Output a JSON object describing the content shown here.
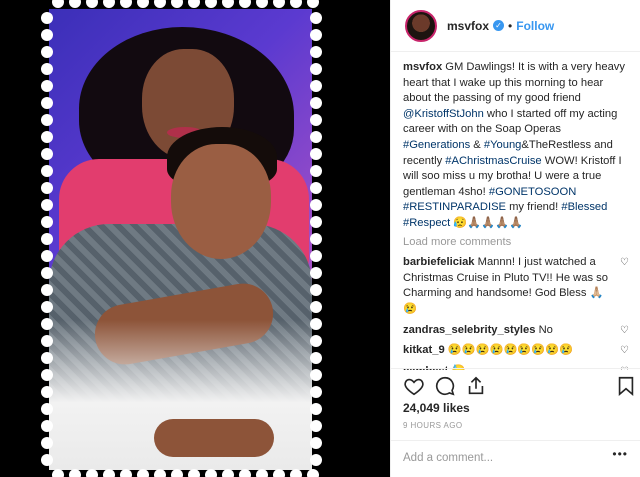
{
  "post": {
    "username": "msvfox",
    "verified_icon": "verified-badge-icon",
    "dot": "•",
    "follow_label": "Follow"
  },
  "caption": {
    "username": "msvfox",
    "parts": [
      {
        "t": "GM Dawlings! It is with a very heavy heart that I wake up this morning to hear about the passing of my good friend ",
        "tag": false
      },
      {
        "t": "@KristoffStJohn",
        "tag": true
      },
      {
        "t": " who I started off my acting career with on the Soap Operas ",
        "tag": false
      },
      {
        "t": "#Generations",
        "tag": true
      },
      {
        "t": " & ",
        "tag": false
      },
      {
        "t": "#Young",
        "tag": true
      },
      {
        "t": "&TheRestless and recently ",
        "tag": false
      },
      {
        "t": "#AChristmasCruise",
        "tag": true
      },
      {
        "t": " WOW! Kristoff I will soo miss u my brotha! U were a true gentleman 4sho! ",
        "tag": false
      },
      {
        "t": "#GONETOSOON",
        "tag": true
      },
      {
        "t": " ",
        "tag": false
      },
      {
        "t": "#RESTINPARADISE",
        "tag": true
      },
      {
        "t": " my friend! ",
        "tag": false
      },
      {
        "t": "#Blessed",
        "tag": true
      },
      {
        "t": " ",
        "tag": false
      },
      {
        "t": "#Respect",
        "tag": true
      },
      {
        "t": " 😥🙏🏽🙏🏽🙏🏽🙏🏽",
        "tag": false
      }
    ]
  },
  "load_more_label": "Load more comments",
  "comments": [
    {
      "user": "barbiefeliciak",
      "text": "Mannn! I just watched a Christmas Cruise in Pluto TV!! He was so Charming and handsome! God Bless 🙏🏼😢"
    },
    {
      "user": "zandras_selebrity_styles",
      "text": "No"
    },
    {
      "user": "kitkat_9",
      "text": "😢😢😢😢😢😢😢😢😢"
    },
    {
      "user": "cambest",
      "text": "😓"
    }
  ],
  "heart_glyph": "♡",
  "actions": {
    "like_icon": "heart-icon",
    "comment_icon": "comment-icon",
    "share_icon": "share-icon",
    "save_icon": "bookmark-icon"
  },
  "likes_text": "24,049 likes",
  "time_ago": "9 HOURS AGO",
  "add_comment_placeholder": "Add a comment...",
  "more_options": "•••",
  "colors": {
    "accent_blue": "#3897f0",
    "tag_blue": "#003569",
    "muted_gray": "#999999",
    "photo_frame_black": "#000000"
  }
}
